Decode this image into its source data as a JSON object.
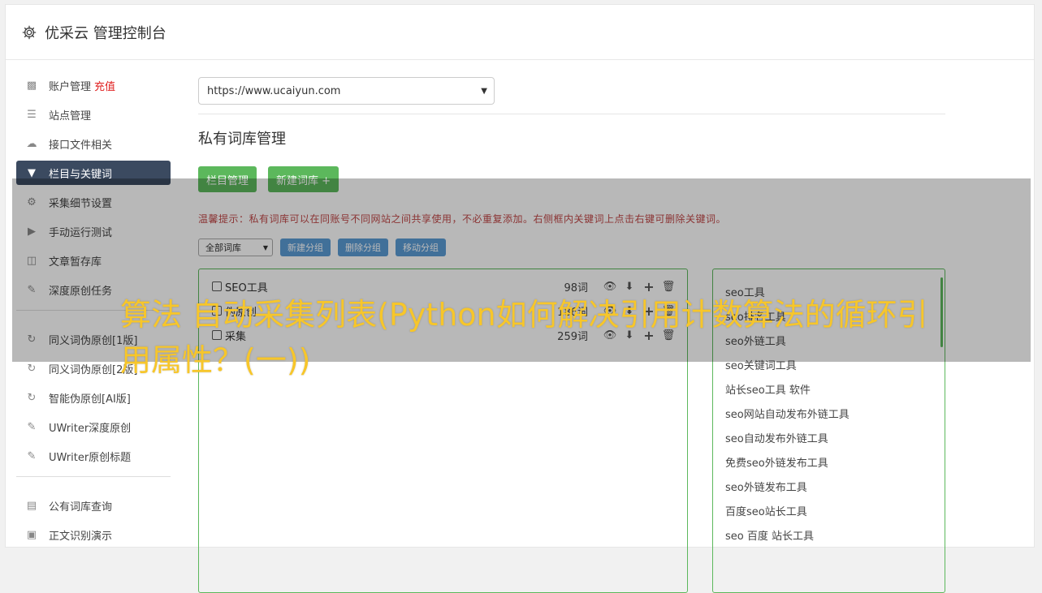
{
  "header": {
    "title": "优采云 管理控制台",
    "icon": "gear-icon"
  },
  "sidebar": {
    "group1": [
      {
        "label": "账户管理",
        "badge": "充值",
        "icon": "bar-chart-icon"
      },
      {
        "label": "站点管理",
        "icon": "server-icon"
      },
      {
        "label": "接口文件相关",
        "icon": "cloud-upload-icon"
      },
      {
        "label": "栏目与关键词",
        "icon": "filter-icon",
        "active": true
      },
      {
        "label": "采集细节设置",
        "icon": "cogs-icon"
      },
      {
        "label": "手动运行测试",
        "icon": "play-circle-icon"
      },
      {
        "label": "文章暂存库",
        "icon": "database-icon"
      },
      {
        "label": "深度原创任务",
        "icon": "edit-icon"
      }
    ],
    "group2": [
      {
        "label": "同义词伪原创[1版]",
        "icon": "refresh-icon"
      },
      {
        "label": "同义词伪原创[2版]",
        "icon": "refresh-icon"
      },
      {
        "label": "智能伪原创[AI版]",
        "icon": "refresh-icon"
      },
      {
        "label": "UWriter深度原创",
        "icon": "edit-icon"
      },
      {
        "label": "UWriter原创标题",
        "icon": "edit-icon"
      }
    ],
    "group3": [
      {
        "label": "公有词库查询",
        "icon": "book-icon"
      },
      {
        "label": "正文识别演示",
        "icon": "monitor-icon"
      }
    ]
  },
  "main": {
    "site_select": "https://www.ucaiyun.com",
    "section_title": "私有词库管理",
    "btn_column_manage": "栏目管理",
    "btn_new_library": "新建词库 +",
    "tip": "温馨提示：私有词库可以在同账号不同网站之间共享使用，不必重复添加。右侧框内关键词上点击右键可删除关键词。",
    "filter_select": "全部词库",
    "btn_new_group": "新建分组",
    "btn_delete_group": "删除分组",
    "btn_move_group": "移动分组",
    "libraries": [
      {
        "name": "SEO工具",
        "count": "98词"
      },
      {
        "name": "伪原创",
        "count": "186词"
      },
      {
        "name": "采集",
        "count": "259词"
      }
    ],
    "keywords": [
      "seo工具",
      "seo排名工具",
      "seo外链工具",
      "seo关键词工具",
      "站长seo工具 软件",
      "seo网站自动发布外链工具",
      "seo自动发布外链工具",
      "免费seo外链发布工具",
      "seo外链发布工具",
      "百度seo站长工具",
      "seo 百度 站长工具"
    ]
  },
  "overlay_caption": "算法 自动采集列表(Python如何解决引用计数算法的循环引用属性？(一))",
  "colors": {
    "accent_green": "#5cb85c",
    "active_nav": "#3b4a60",
    "blue_btn": "#5b9bd5",
    "caption": "#f7c62a",
    "tip_red": "#c14949"
  }
}
